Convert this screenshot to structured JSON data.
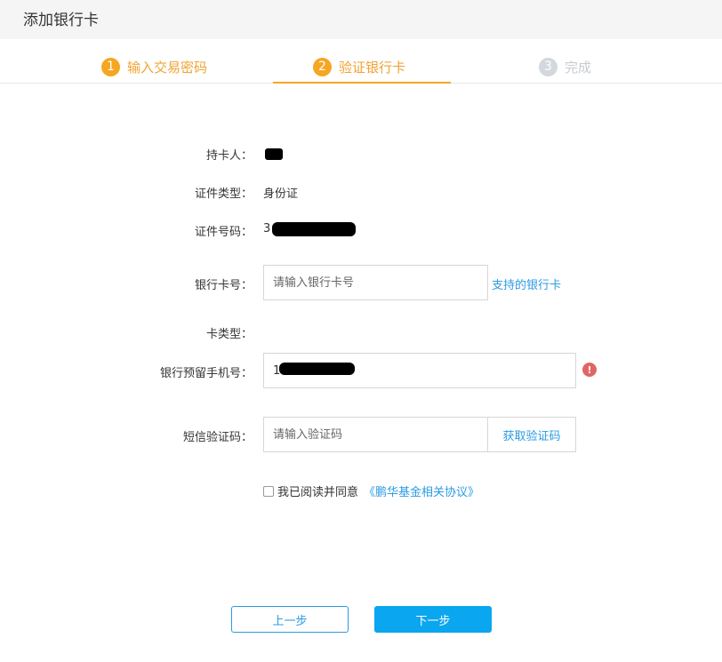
{
  "header": {
    "title": "添加银行卡"
  },
  "steps": [
    {
      "num": "1",
      "label": "输入交易密码",
      "state": "done"
    },
    {
      "num": "2",
      "label": "验证银行卡",
      "state": "active"
    },
    {
      "num": "3",
      "label": "完成",
      "state": "todo"
    }
  ],
  "form": {
    "holder_label": "持卡人：",
    "id_type_label": "证件类型：",
    "id_type_value": "身份证",
    "id_number_label": "证件号码：",
    "id_number_value": "3",
    "card_number_label": "银行卡号：",
    "card_number_placeholder": "请输入银行卡号",
    "supported_banks_link": "支持的银行卡",
    "card_type_label": "卡类型：",
    "phone_label": "银行预留手机号：",
    "phone_value": "1",
    "error_icon_glyph": "!",
    "sms_label": "短信验证码：",
    "sms_placeholder": "请输入验证码",
    "sms_button": "获取验证码"
  },
  "agreement": {
    "text": "我已阅读并同意",
    "link": "《鹏华基金相关协议》",
    "checked": false
  },
  "buttons": {
    "prev": "上一步",
    "next": "下一步"
  },
  "colors": {
    "accent_orange": "#f6a623",
    "link_blue": "#2b9be3",
    "primary_blue": "#0aa6f0",
    "error_red": "#e06666"
  }
}
